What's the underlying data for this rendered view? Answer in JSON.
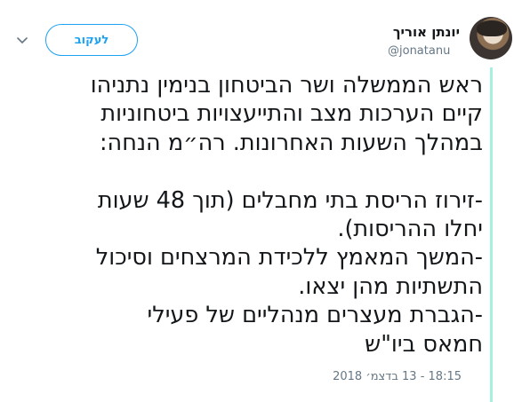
{
  "author": {
    "display_name": "יונתן אוריך",
    "handle": "@jonatanu"
  },
  "actions": {
    "follow_label": "לעקוב",
    "more_icon": "chevron-down-icon"
  },
  "tweet": {
    "text": "ראש הממשלה ושר הביטחון בנימין נתניהו\nקיים הערכות מצב והתייעצויות ביטחוניות\nבמהלך השעות האחרונות. רה״מ הנחה:\n\n-זירוז הריסת בתי מחבלים (תוך 48 שעות\nיחלו ההריסות).\n-המשך המאמץ ללכידת המרצחים וסיכול\nהתשתיות מהן יצאו.\n-הגברת מעצרים מנהליים של פעילי\nחמאס ביו\"ש",
    "timestamp": "18:15 - 13 בדצמ׳ 2018"
  },
  "colors": {
    "accent": "#1da1f2",
    "rail": "#a6f1dd",
    "muted": "#657786",
    "text": "#14171a"
  }
}
